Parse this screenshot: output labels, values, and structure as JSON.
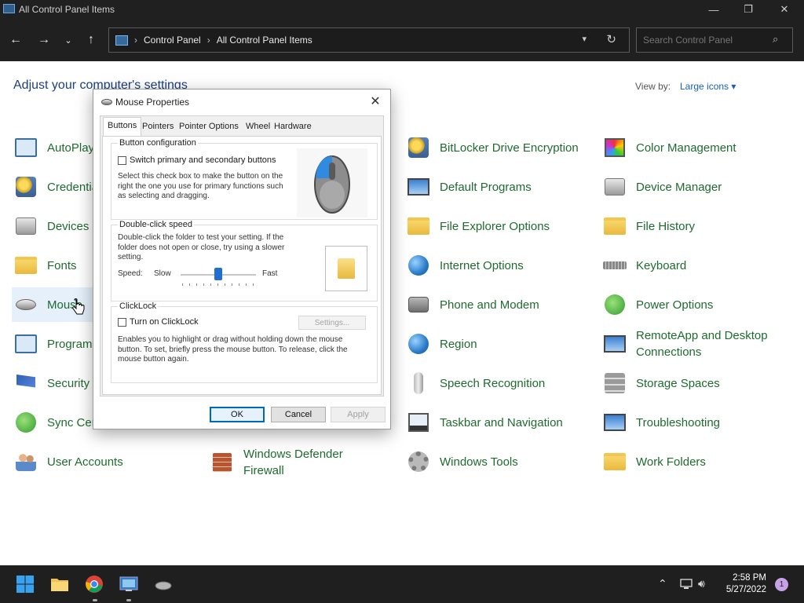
{
  "window": {
    "title": "All Control Panel Items"
  },
  "address": {
    "crumbs": [
      "Control Panel",
      "All Control Panel Items"
    ],
    "search_placeholder": "Search Control Panel"
  },
  "content": {
    "heading": "Adjust your computer's settings",
    "view_by_label": "View by:",
    "view_by_value": "Large icons ▾",
    "items": [
      {
        "label": "AutoPlay"
      },
      {
        "label": "Credential Manager"
      },
      {
        "label": "Devices and Printers"
      },
      {
        "label": "Fonts"
      },
      {
        "label": "Mouse"
      },
      {
        "label": "Programs and Features"
      },
      {
        "label": "Security and Maintenance"
      },
      {
        "label": "Sync Center"
      },
      {
        "label": "User Accounts"
      },
      {
        "label": "Windows Defender Firewall"
      },
      {
        "label": "BitLocker Drive Encryption"
      },
      {
        "label": "Default Programs"
      },
      {
        "label": "File Explorer Options"
      },
      {
        "label": "Internet Options"
      },
      {
        "label": "Phone and Modem"
      },
      {
        "label": "Region"
      },
      {
        "label": "Speech Recognition"
      },
      {
        "label": "Taskbar and Navigation"
      },
      {
        "label": "Windows Tools"
      },
      {
        "label": "Color Management"
      },
      {
        "label": "Device Manager"
      },
      {
        "label": "File History"
      },
      {
        "label": "Keyboard"
      },
      {
        "label": "Power Options"
      },
      {
        "label": "RemoteApp and Desktop Connections"
      },
      {
        "label": "Storage Spaces"
      },
      {
        "label": "Troubleshooting"
      },
      {
        "label": "Work Folders"
      }
    ]
  },
  "dialog": {
    "title": "Mouse Properties",
    "tabs": [
      "Buttons",
      "Pointers",
      "Pointer Options",
      "Wheel",
      "Hardware"
    ],
    "button_config": {
      "title": "Button configuration",
      "checkbox": "Switch primary and secondary buttons",
      "desc": "Select this check box to make the button on the right the one you use for primary functions such as selecting and dragging."
    },
    "dblclick": {
      "title": "Double-click speed",
      "desc": "Double-click the folder to test your setting. If the folder does not open or close, try using a slower setting.",
      "speed_label": "Speed:",
      "slow": "Slow",
      "fast": "Fast",
      "speed_value": 0.5
    },
    "clicklock": {
      "title": "ClickLock",
      "checkbox": "Turn on ClickLock",
      "settings": "Settings...",
      "desc": "Enables you to highlight or drag without holding down the mouse button. To set, briefly press the mouse button. To release, click the mouse button again."
    },
    "buttons": {
      "ok": "OK",
      "cancel": "Cancel",
      "apply": "Apply"
    }
  },
  "taskbar": {
    "time": "2:58 PM",
    "date": "5/27/2022",
    "notifications": "1"
  }
}
